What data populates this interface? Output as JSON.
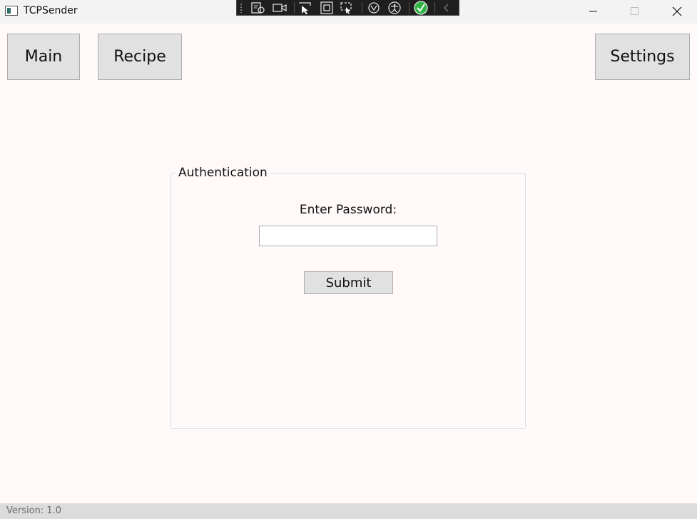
{
  "window": {
    "title": "TCPSender",
    "minimize_icon": "minimize-icon",
    "maximize_icon": "maximize-icon",
    "close_icon": "close-icon"
  },
  "debug_toolbar": {
    "icons": [
      "live-visual-tree-icon",
      "record-icon",
      "select-element-icon",
      "display-layout-adorners-icon",
      "track-focus-icon",
      "hot-reload-icon",
      "accessibility-icon",
      "binding-check-icon",
      "collapse-chevron-icon"
    ],
    "check_color": "#2fb344"
  },
  "nav": {
    "main_label": "Main",
    "recipe_label": "Recipe",
    "settings_label": "Settings"
  },
  "auth": {
    "group_title": "Authentication",
    "password_label": "Enter Password:",
    "password_value": "",
    "submit_label": "Submit"
  },
  "status": {
    "version": "Version: 1.0"
  }
}
